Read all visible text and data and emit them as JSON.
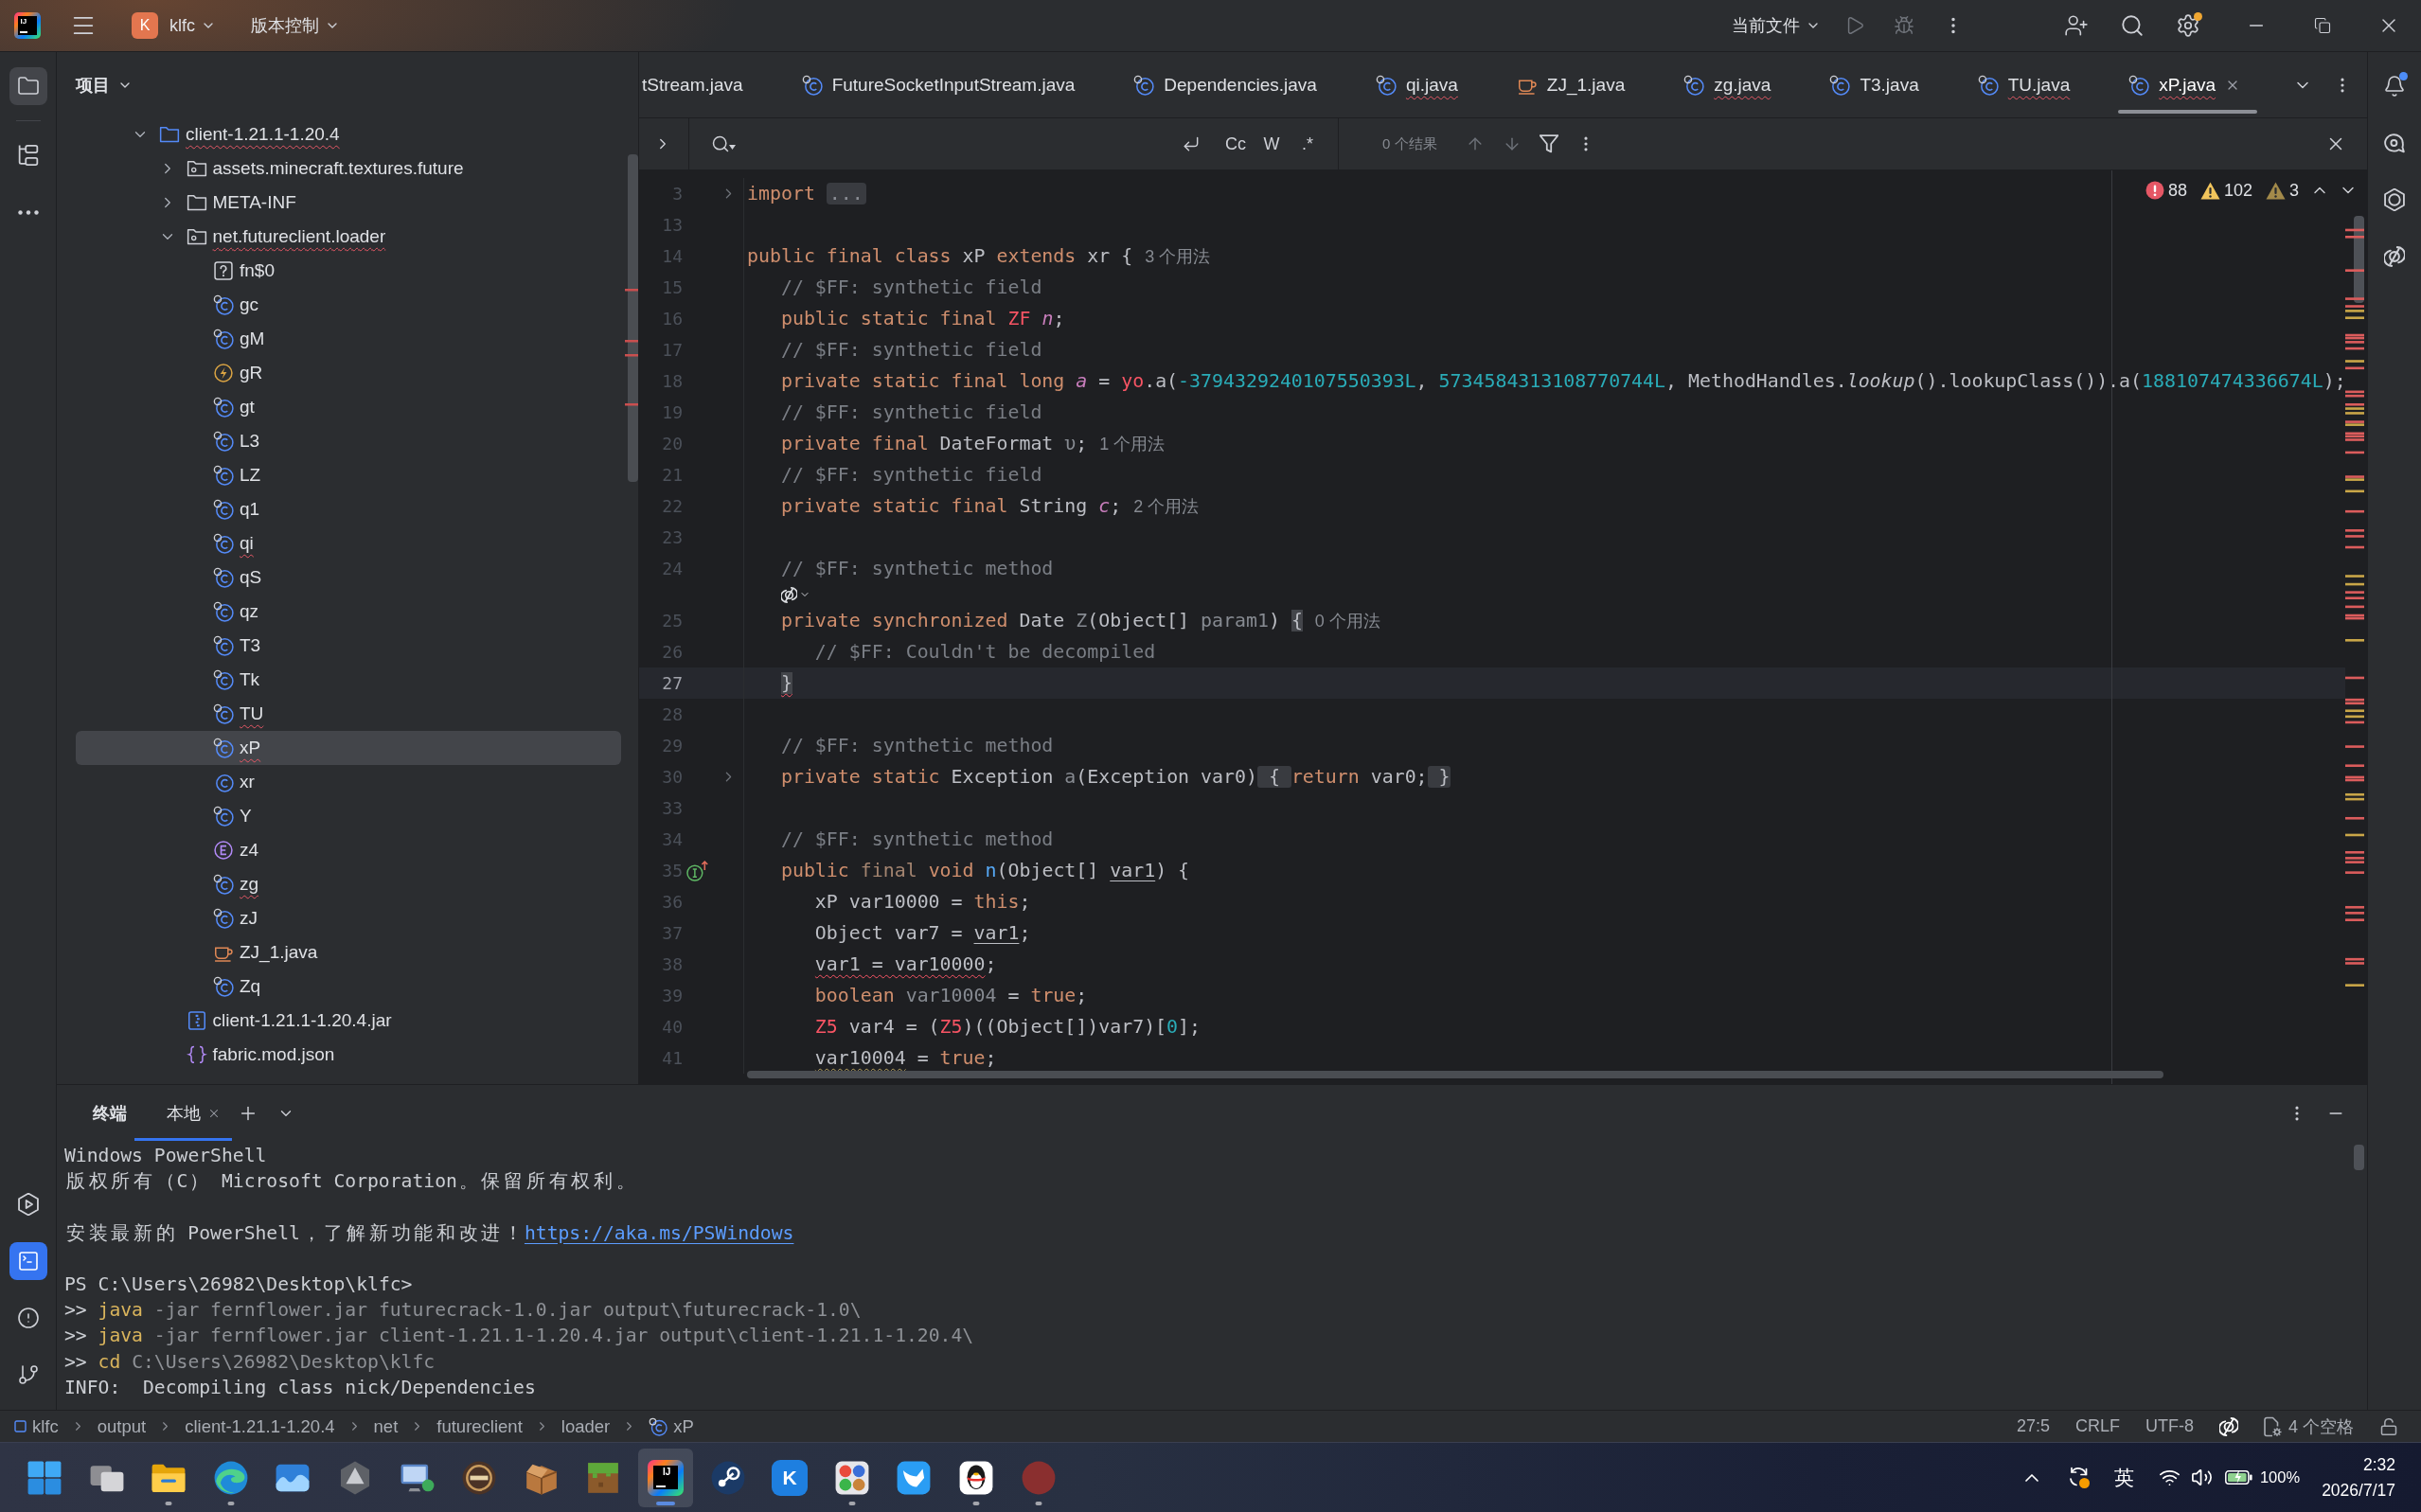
{
  "title_bar": {
    "app_logo": "IJ",
    "project": {
      "badge": "K",
      "name": "klfc"
    },
    "vcs_menu": "版本控制",
    "run_configuration": "当前文件",
    "run_disabled": true,
    "settings_badge": true
  },
  "left_strip": {
    "top": [
      {
        "kind": "project",
        "selected": true,
        "focused": false
      },
      {
        "kind": "structure",
        "selected": false,
        "focused": false
      },
      {
        "kind": "more",
        "selected": false,
        "focused": false
      }
    ],
    "bottom": [
      {
        "kind": "services",
        "selected": false,
        "focused": false
      },
      {
        "kind": "terminal",
        "selected": true,
        "focused": true
      },
      {
        "kind": "problems",
        "selected": false,
        "focused": false
      },
      {
        "kind": "git",
        "selected": false,
        "focused": false
      }
    ]
  },
  "project_panel": {
    "title": "项目",
    "tree": [
      {
        "label": "client-1.21.1-1.20.4",
        "kind": "module",
        "expanded": true,
        "error": true,
        "selected": false,
        "children": [
          {
            "label": "assets.minecraft.textures.future",
            "kind": "package",
            "expanded": false,
            "error": false,
            "selected": false
          },
          {
            "label": "META-INF",
            "kind": "folder",
            "expanded": false,
            "error": false,
            "selected": false
          },
          {
            "label": "net.futureclient.loader",
            "kind": "package",
            "expanded": true,
            "error": true,
            "selected": false,
            "children": [
              {
                "label": "fn$0",
                "kind": "unknown",
                "error": false,
                "selected": false
              },
              {
                "label": "gc",
                "kind": "compiled",
                "error": false,
                "selected": false
              },
              {
                "label": "gM",
                "kind": "compiled",
                "error": false,
                "selected": false
              },
              {
                "label": "gR",
                "kind": "exception",
                "error": false,
                "selected": false
              },
              {
                "label": "gt",
                "kind": "compiled",
                "error": false,
                "selected": false
              },
              {
                "label": "L3",
                "kind": "compiled",
                "error": false,
                "selected": false
              },
              {
                "label": "LZ",
                "kind": "compiled",
                "error": false,
                "selected": false
              },
              {
                "label": "q1",
                "kind": "compiled",
                "error": false,
                "selected": false
              },
              {
                "label": "qi",
                "kind": "compiled",
                "error": true,
                "selected": false
              },
              {
                "label": "qS",
                "kind": "compiled",
                "error": false,
                "selected": false
              },
              {
                "label": "qz",
                "kind": "compiled",
                "error": false,
                "selected": false
              },
              {
                "label": "T3",
                "kind": "compiled",
                "error": false,
                "selected": false
              },
              {
                "label": "Tk",
                "kind": "compiled",
                "error": false,
                "selected": false
              },
              {
                "label": "TU",
                "kind": "compiled",
                "error": true,
                "selected": false
              },
              {
                "label": "xP",
                "kind": "compiled",
                "error": true,
                "selected": true
              },
              {
                "label": "xr",
                "kind": "class",
                "error": false,
                "selected": false
              },
              {
                "label": "Y",
                "kind": "compiled",
                "error": false,
                "selected": false
              },
              {
                "label": "z4",
                "kind": "enum",
                "error": false,
                "selected": false
              },
              {
                "label": "zg",
                "kind": "compiled",
                "error": true,
                "selected": false
              },
              {
                "label": "zJ",
                "kind": "compiled",
                "error": false,
                "selected": false
              },
              {
                "label": "ZJ_1.java",
                "kind": "java",
                "error": false,
                "selected": false
              },
              {
                "label": "Zq",
                "kind": "compiled",
                "error": false,
                "selected": false
              }
            ]
          },
          {
            "label": "client-1.21.1-1.20.4.jar",
            "kind": "archive",
            "error": false,
            "selected": false
          },
          {
            "label": "fabric.mod.json",
            "kind": "json",
            "error": false,
            "selected": false
          }
        ]
      }
    ]
  },
  "editor": {
    "tabs": [
      {
        "label": "tStream.java",
        "kind": "none",
        "selected": false,
        "error": false
      },
      {
        "label": "FutureSocketInputStream.java",
        "kind": "compiled",
        "selected": false,
        "error": false
      },
      {
        "label": "Dependencies.java",
        "kind": "compiled",
        "selected": false,
        "error": false
      },
      {
        "label": "qi.java",
        "kind": "compiled",
        "selected": false,
        "error": true
      },
      {
        "label": "ZJ_1.java",
        "kind": "java",
        "selected": false,
        "error": false
      },
      {
        "label": "zg.java",
        "kind": "compiled",
        "selected": false,
        "error": true
      },
      {
        "label": "T3.java",
        "kind": "compiled",
        "selected": false,
        "error": false
      },
      {
        "label": "TU.java",
        "kind": "compiled",
        "selected": false,
        "error": true
      },
      {
        "label": "xP.java",
        "kind": "compiled",
        "selected": true,
        "error": true
      }
    ],
    "find_bar": {
      "toggles": [
        {
          "label": "Cc",
          "on": false
        },
        {
          "label": "W",
          "on": false
        },
        {
          "label": ".*",
          "on": false
        }
      ],
      "result": "0 个结果"
    },
    "problems": {
      "errors": "88",
      "warnings": "102",
      "weak_warnings": "3"
    },
    "lines": [
      {
        "kind": "code",
        "number": "3",
        "current": false,
        "marker": {
          "kind": "fold"
        },
        "tokens": [
          {
            "text": "import",
            "kind": "keyword"
          },
          {
            "text": "...",
            "kind": "fold"
          }
        ]
      },
      {
        "kind": "code",
        "number": "13",
        "current": false
      },
      {
        "kind": "code",
        "number": "14",
        "current": false,
        "tokens": [
          {
            "text": "public final class ",
            "kind": "keyword"
          },
          {
            "text": "xP ",
            "kind": "plain"
          },
          {
            "text": "extends",
            "kind": "keyword"
          },
          {
            "text": " xr {",
            "kind": "plain"
          },
          {
            "text": "3 个用法",
            "kind": "hint"
          }
        ]
      },
      {
        "kind": "code",
        "number": "15",
        "current": false,
        "tokens": [
          {
            "text": "   // $FF: synthetic field",
            "kind": "comment"
          }
        ]
      },
      {
        "kind": "code",
        "number": "16",
        "current": false,
        "tokens": [
          {
            "text": "   public static final ",
            "kind": "keyword"
          },
          {
            "text": "ZF ",
            "kind": "error"
          },
          {
            "text": "n",
            "kind": "field"
          },
          {
            "text": ";",
            "kind": "plain"
          }
        ]
      },
      {
        "kind": "code",
        "number": "17",
        "current": false,
        "tokens": [
          {
            "text": "   // $FF: synthetic field",
            "kind": "comment"
          }
        ]
      },
      {
        "kind": "code",
        "number": "18",
        "current": false,
        "tokens": [
          {
            "text": "   private static final long ",
            "kind": "keyword"
          },
          {
            "text": "a",
            "kind": "field"
          },
          {
            "text": " = ",
            "kind": "plain"
          },
          {
            "text": "yo",
            "kind": "error"
          },
          {
            "text": ".a(",
            "kind": "plain"
          },
          {
            "text": "-3794329240107550393L",
            "kind": "number"
          },
          {
            "text": ", ",
            "kind": "plain"
          },
          {
            "text": "5734584313108770744L",
            "kind": "number"
          },
          {
            "text": ", MethodHandles.",
            "kind": "plain"
          },
          {
            "text": "lookup",
            "kind": "italic"
          },
          {
            "text": "().lookupClass()).a(",
            "kind": "plain"
          },
          {
            "text": "188107474336674L",
            "kind": "number"
          },
          {
            "text": ");",
            "kind": "plain"
          }
        ]
      },
      {
        "kind": "code",
        "number": "19",
        "current": false,
        "tokens": [
          {
            "text": "   // $FF: synthetic field",
            "kind": "comment"
          }
        ]
      },
      {
        "kind": "code",
        "number": "20",
        "current": false,
        "tokens": [
          {
            "text": "   private final ",
            "kind": "keyword"
          },
          {
            "text": "DateFormat ",
            "kind": "plain"
          },
          {
            "text": "υ",
            "kind": "unused"
          },
          {
            "text": ";",
            "kind": "plain"
          },
          {
            "text": "1 个用法",
            "kind": "hint"
          }
        ]
      },
      {
        "kind": "code",
        "number": "21",
        "current": false,
        "tokens": [
          {
            "text": "   // $FF: synthetic field",
            "kind": "comment"
          }
        ]
      },
      {
        "kind": "code",
        "number": "22",
        "current": false,
        "tokens": [
          {
            "text": "   private static final ",
            "kind": "keyword"
          },
          {
            "text": "String ",
            "kind": "plain"
          },
          {
            "text": "c",
            "kind": "field"
          },
          {
            "text": ";",
            "kind": "plain"
          },
          {
            "text": "2 个用法",
            "kind": "hint"
          }
        ]
      },
      {
        "kind": "code",
        "number": "23",
        "current": false
      },
      {
        "kind": "code",
        "number": "24",
        "current": false,
        "tokens": [
          {
            "text": "   // $FF: synthetic method",
            "kind": "comment"
          }
        ]
      },
      {
        "kind": "inlay"
      },
      {
        "kind": "code",
        "number": "25",
        "current": false,
        "tokens": [
          {
            "text": "   private synchronized ",
            "kind": "keyword"
          },
          {
            "text": "Date ",
            "kind": "plain"
          },
          {
            "text": "Z",
            "kind": "unused"
          },
          {
            "text": "(Object[] ",
            "kind": "plain"
          },
          {
            "text": "param1",
            "kind": "unused"
          },
          {
            "text": ") ",
            "kind": "plain"
          },
          {
            "text": "{",
            "kind": "brace"
          },
          {
            "text": "0 个用法",
            "kind": "hint"
          }
        ]
      },
      {
        "kind": "code",
        "number": "26",
        "current": false,
        "tokens": [
          {
            "text": "      // $FF: Couldn't be decompiled",
            "kind": "comment"
          }
        ]
      },
      {
        "kind": "code",
        "number": "27",
        "current": true,
        "tokens": [
          {
            "text": "   }",
            "kind": "bracesquiggle"
          }
        ]
      },
      {
        "kind": "code",
        "number": "28",
        "current": false
      },
      {
        "kind": "code",
        "number": "29",
        "current": false,
        "tokens": [
          {
            "text": "   // $FF: synthetic method",
            "kind": "comment"
          }
        ]
      },
      {
        "kind": "code",
        "number": "30",
        "current": false,
        "marker": {
          "kind": "fold"
        },
        "tokens": [
          {
            "text": "   private static ",
            "kind": "keyword"
          },
          {
            "text": "Exception ",
            "kind": "plain"
          },
          {
            "text": "a",
            "kind": "unused"
          },
          {
            "text": "(Exception var0)",
            "kind": "plain"
          },
          {
            "text": " { ",
            "kind": "foldbrace"
          },
          {
            "text": "return",
            "kind": "keyword"
          },
          {
            "text": " var0;",
            "kind": "plain"
          },
          {
            "text": " }",
            "kind": "foldbrace"
          }
        ]
      },
      {
        "kind": "code",
        "number": "33",
        "current": false
      },
      {
        "kind": "code",
        "number": "34",
        "current": false,
        "tokens": [
          {
            "text": "   // $FF: synthetic method",
            "kind": "comment"
          }
        ]
      },
      {
        "kind": "code",
        "number": "35",
        "current": false,
        "marker": {
          "kind": "implements"
        },
        "tokens": [
          {
            "text": "   public ",
            "kind": "keyword"
          },
          {
            "text": "final",
            "kind": "dimkeyword"
          },
          {
            "text": " void ",
            "kind": "keyword"
          },
          {
            "text": "n",
            "kind": "method"
          },
          {
            "text": "(Object[] ",
            "kind": "plain"
          },
          {
            "text": "var1",
            "kind": "underline"
          },
          {
            "text": ") {",
            "kind": "plain"
          }
        ]
      },
      {
        "kind": "code",
        "number": "36",
        "current": false,
        "tokens": [
          {
            "text": "      xP var10000 = ",
            "kind": "plain"
          },
          {
            "text": "this",
            "kind": "keyword"
          },
          {
            "text": ";",
            "kind": "plain"
          }
        ]
      },
      {
        "kind": "code",
        "number": "37",
        "current": false,
        "tokens": [
          {
            "text": "      Object var7 = ",
            "kind": "plain"
          },
          {
            "text": "var1",
            "kind": "underline"
          },
          {
            "text": ";",
            "kind": "plain"
          }
        ]
      },
      {
        "kind": "code",
        "number": "38",
        "current": false,
        "tokens": [
          {
            "text": "      var1 = var10000",
            "kind": "squiggle"
          },
          {
            "text": ";",
            "kind": "plain"
          }
        ]
      },
      {
        "kind": "code",
        "number": "39",
        "current": false,
        "tokens": [
          {
            "text": "      boolean ",
            "kind": "keyword"
          },
          {
            "text": "var10004",
            "kind": "unused"
          },
          {
            "text": " = ",
            "kind": "plain"
          },
          {
            "text": "true",
            "kind": "keyword"
          },
          {
            "text": ";",
            "kind": "plain"
          }
        ]
      },
      {
        "kind": "code",
        "number": "40",
        "current": false,
        "tokens": [
          {
            "text": "      Z5",
            "kind": "error"
          },
          {
            "text": " var4 = (",
            "kind": "plain"
          },
          {
            "text": "Z5",
            "kind": "error"
          },
          {
            "text": ")((Object[])var7)[",
            "kind": "plain"
          },
          {
            "text": "0",
            "kind": "number"
          },
          {
            "text": "];",
            "kind": "plain"
          }
        ]
      },
      {
        "kind": "code",
        "number": "41",
        "current": false,
        "tokens": [
          {
            "text": "      var10004",
            "kind": "warning"
          },
          {
            "text": " = ",
            "kind": "plain"
          },
          {
            "text": "true",
            "kind": "keyword"
          },
          {
            "text": ";",
            "kind": "plain"
          }
        ]
      }
    ]
  },
  "right_strip": [
    {
      "kind": "notifications",
      "selected": false,
      "badge": true
    },
    {
      "kind": "chat",
      "selected": false,
      "badge": false
    },
    {
      "kind": "ring",
      "selected": false,
      "badge": false
    },
    {
      "kind": "assistant",
      "selected": false,
      "badge": false
    }
  ],
  "terminal": {
    "title": "终端",
    "tabs": [
      {
        "label": "本地",
        "selected": true
      }
    ],
    "lines": [
      {
        "kind": "text",
        "segments": [
          {
            "text": "Windows PowerShell",
            "kind": "output"
          }
        ]
      },
      {
        "kind": "text",
        "segments": [
          {
            "text": "版权所有（C） Microsoft Corporation。保留所有权利。",
            "kind": "output"
          }
        ]
      },
      {
        "kind": "blank"
      },
      {
        "kind": "text",
        "segments": [
          {
            "text": "安装最新的 PowerShell，了解新功能和改进！",
            "kind": "output"
          },
          {
            "text": "https://aka.ms/PSWindows",
            "kind": "link"
          }
        ]
      },
      {
        "kind": "blank"
      },
      {
        "kind": "text",
        "segments": [
          {
            "text": "PS C:\\Users\\26982\\Desktop\\klfc>",
            "kind": "output"
          }
        ]
      },
      {
        "kind": "text",
        "segments": [
          {
            "text": ">> ",
            "kind": "output"
          },
          {
            "text": "java",
            "kind": "command"
          },
          {
            "text": " -jar fernflower.jar futurecrack-1.0.jar output\\futurecrack-1.0\\",
            "kind": "argument"
          }
        ]
      },
      {
        "kind": "text",
        "segments": [
          {
            "text": ">> ",
            "kind": "output"
          },
          {
            "text": "java",
            "kind": "command"
          },
          {
            "text": " -jar fernflower.jar client-1.21.1-1.20.4.jar output\\client-1.21.1-1.20.4\\",
            "kind": "argument"
          }
        ]
      },
      {
        "kind": "text",
        "segments": [
          {
            "text": ">> ",
            "kind": "output"
          },
          {
            "text": "cd",
            "kind": "command"
          },
          {
            "text": " C:\\Users\\26982\\Desktop\\klfc",
            "kind": "argument"
          }
        ]
      },
      {
        "kind": "text",
        "segments": [
          {
            "text": "INFO:  Decompiling class nick/Dependencies",
            "kind": "output"
          }
        ]
      }
    ]
  },
  "status_bar": {
    "breadcrumbs": [
      {
        "label": "klfc",
        "kind": "module"
      },
      {
        "label": "output",
        "kind": "folder"
      },
      {
        "label": "client-1.21.1-1.20.4",
        "kind": "folder"
      },
      {
        "label": "net",
        "kind": "folder"
      },
      {
        "label": "futureclient",
        "kind": "folder"
      },
      {
        "label": "loader",
        "kind": "folder"
      },
      {
        "label": "xP",
        "kind": "compiled"
      }
    ],
    "position": "27:5",
    "line_separator": "CRLF",
    "encoding": "UTF-8",
    "indent": "4 个空格"
  },
  "taskbar": {
    "apps": [
      {
        "kind": "start",
        "running": false,
        "selected": false
      },
      {
        "kind": "taskview",
        "running": false,
        "selected": false
      },
      {
        "kind": "explorer",
        "running": true,
        "selected": false
      },
      {
        "kind": "browser",
        "running": true,
        "selected": false
      },
      {
        "kind": "photos",
        "running": false,
        "selected": false
      },
      {
        "kind": "hexagon",
        "running": false,
        "selected": false
      },
      {
        "kind": "computer",
        "running": false,
        "selected": false
      },
      {
        "kind": "launcher",
        "running": false,
        "selected": false
      },
      {
        "kind": "package",
        "running": false,
        "selected": false
      },
      {
        "kind": "block",
        "running": false,
        "selected": false
      },
      {
        "kind": "ide",
        "label": "IJ",
        "running": true,
        "selected": true
      },
      {
        "kind": "disc",
        "running": false,
        "selected": false
      },
      {
        "kind": "letter",
        "label": "K",
        "running": false,
        "selected": false
      },
      {
        "kind": "grid",
        "running": true,
        "selected": false
      },
      {
        "kind": "bird",
        "running": false,
        "selected": false
      },
      {
        "kind": "penguin",
        "running": true,
        "selected": false
      },
      {
        "kind": "avatar",
        "running": true,
        "selected": false
      }
    ],
    "tray": {
      "input_method": "英",
      "battery": "100%",
      "time": "2:32",
      "date": "2026/7/17"
    }
  }
}
